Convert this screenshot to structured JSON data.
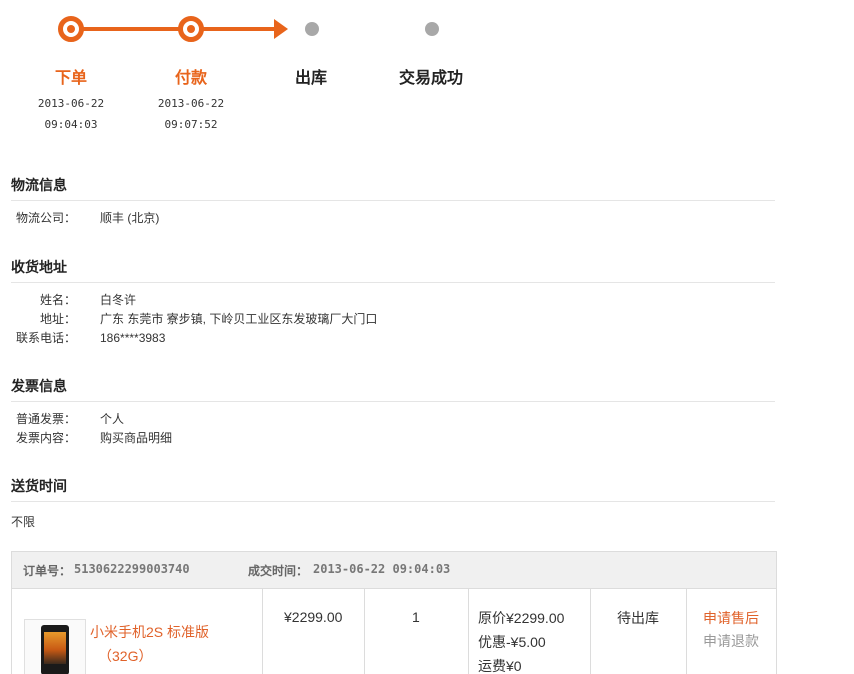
{
  "steps": [
    {
      "label": "下单",
      "date": "2013-06-22",
      "time": "09:04:03",
      "state": "done"
    },
    {
      "label": "付款",
      "date": "2013-06-22",
      "time": "09:07:52",
      "state": "done"
    },
    {
      "label": "出库",
      "state": "pending"
    },
    {
      "label": "交易成功",
      "state": "pending"
    }
  ],
  "logistics": {
    "title": "物流信息",
    "company_label": "物流公司：",
    "company_value": "顺丰 (北京)"
  },
  "address": {
    "title": "收货地址",
    "name_label": "姓名：",
    "name_value": "白冬许",
    "addr_label": "地址：",
    "addr_value": "广东 东莞市 寮步镇, 下岭贝工业区东发玻璃厂大门口",
    "phone_label": "联系电话：",
    "phone_value": "186****3983"
  },
  "invoice": {
    "title": "发票信息",
    "type_label": "普通发票：",
    "type_value": "个人",
    "content_label": "发票内容：",
    "content_value": "购买商品明细"
  },
  "delivery": {
    "title": "送货时间",
    "value": "不限"
  },
  "order": {
    "number_label": "订单号：",
    "number_value": "5130622299003740",
    "time_label": "成交时间：",
    "time_value": "2013-06-22  09:04:03",
    "product_name": "小米手机2S 标准版",
    "product_spec": "（32G）",
    "price": "¥2299.00",
    "quantity": "1",
    "original_price": "原价¥2299.00",
    "discount": "优惠-¥5.00",
    "shipping": "运费¥0",
    "status": "待出库",
    "action_after_sale": "申请售后",
    "action_refund": "申请退款"
  },
  "colors": {
    "accent": "#e8641b",
    "pending_node": "#a8a8a8"
  }
}
